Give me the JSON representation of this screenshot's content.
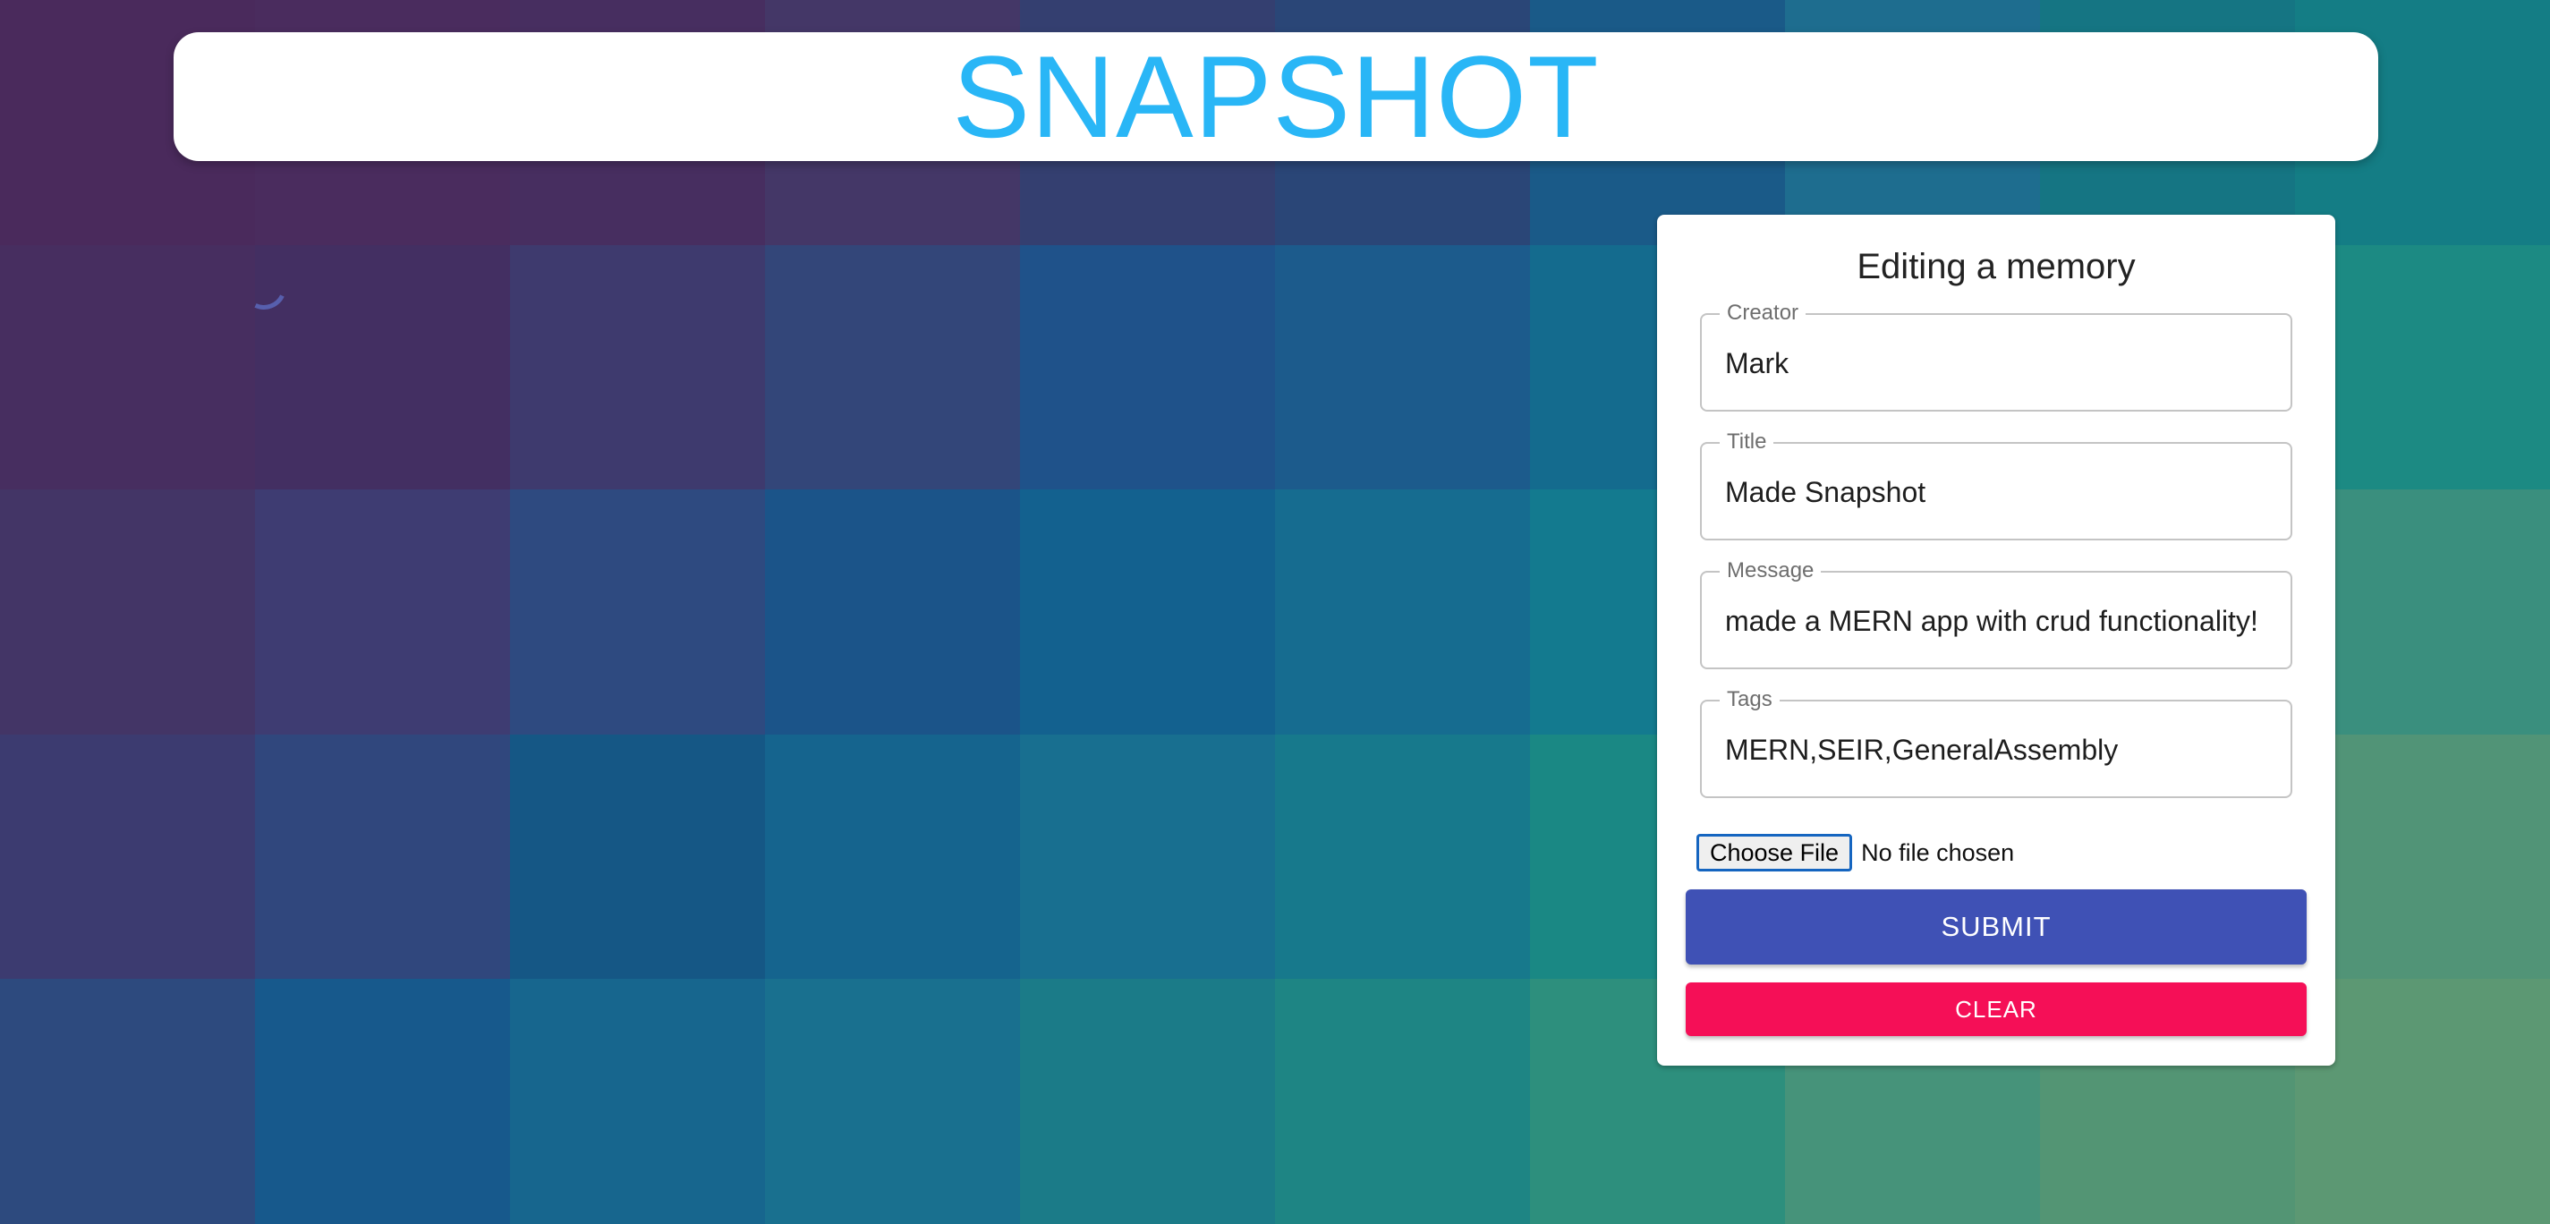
{
  "app": {
    "title": "SNAPSHOT",
    "brand_color": "#29b6f6"
  },
  "background": {
    "tiles": [
      [
        "#4a2a5c",
        "#4a2c5e",
        "#472e60",
        "#443767",
        "#343f70",
        "#2a4677",
        "#1a5a88",
        "#1e6d8f",
        "#157583",
        "#147d85"
      ],
      [
        "#472e60",
        "#432f62",
        "#3e3a6e",
        "#334679",
        "#1f528a",
        "#1c5b8c",
        "#146b8e",
        "#177388",
        "#168585",
        "#1c8a83"
      ],
      [
        "#433566",
        "#3e3c72",
        "#2e4a80",
        "#1b5489",
        "#13618f",
        "#166c90",
        "#137a8f",
        "#197c89",
        "#2a8c82",
        "#3a8f7e"
      ],
      [
        "#3c3b70",
        "#30477d",
        "#155785",
        "#15648e",
        "#186f90",
        "#17798c",
        "#1a8884",
        "#2b8c7e",
        "#3e9179",
        "#519477"
      ],
      [
        "#2d4a7e",
        "#17598c",
        "#17668e",
        "#19708f",
        "#1b7b88",
        "#1e8584",
        "#2d8f7d",
        "#46937a",
        "#539574",
        "#5c9873"
      ]
    ]
  },
  "form": {
    "heading": "Editing a memory",
    "fields": [
      {
        "label": "Creator",
        "value": "Mark"
      },
      {
        "label": "Title",
        "value": "Made Snapshot"
      },
      {
        "label": "Message",
        "value": "made a MERN app with crud functionality!"
      },
      {
        "label": "Tags",
        "value": "MERN,SEIR,GeneralAssembly"
      }
    ],
    "file": {
      "button_label": "Choose File",
      "status": "No file chosen"
    },
    "submit_label": "SUBMIT",
    "clear_label": "CLEAR",
    "submit_color": "#3f51b5",
    "clear_color": "#f50f57"
  }
}
